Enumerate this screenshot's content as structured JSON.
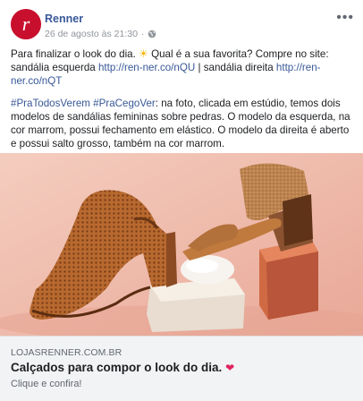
{
  "post": {
    "page_name": "Renner",
    "timestamp": "26 de agosto às 21:30",
    "separator": " · ",
    "privacy_icon": "globe-icon",
    "more_icon": "more-options-icon",
    "avatar_letter": "r",
    "colors": {
      "brand": "#c8102e",
      "link": "#385898",
      "heart": "#e0245e"
    }
  },
  "text": {
    "p1_a": "Para finalizar o look do dia. ",
    "p1_emoji": "☀",
    "p1_b": " Qual é a sua favorita? Compre no site: sandália esquerda ",
    "p1_link1": "http://ren-ner.co/nQU",
    "p1_c": " | sandália direita ",
    "p1_link2": "http://ren-ner.co/nQT",
    "p2_tag1": "#PraTodosVerem",
    "p2_tag2": "#PraCegoVer",
    "p2_text": ": na foto, clicada em estúdio, temos dois modelos de sandálias femininas sobre pedras. O modelo da esquerda, na cor marrom, possui fechamento em elástico. O modelo da direita é aberto e possui salto grosso, também na cor marrom."
  },
  "preview": {
    "domain": "LOJASRENNER.COM.BR",
    "title": "Calçados para compor o look do dia.",
    "heart": "❤",
    "subtitle": "Clique e confira!"
  }
}
